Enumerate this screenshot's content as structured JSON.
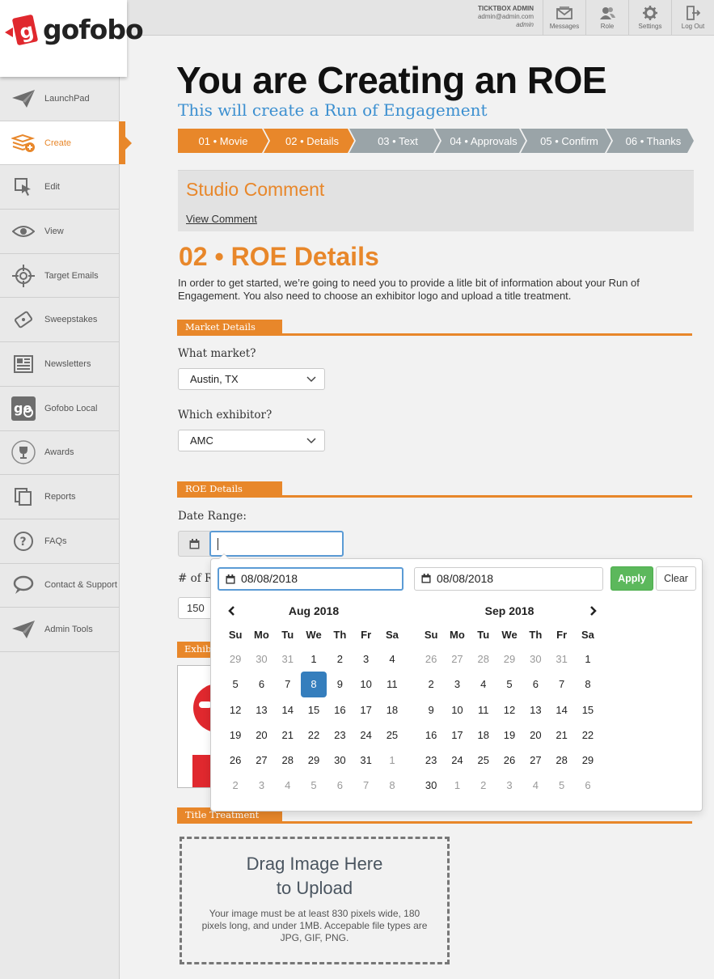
{
  "brand": {
    "name": "gofobo",
    "accent": "#e8872a",
    "link_blue": "#3b8fd0"
  },
  "topbar": {
    "user_name": "TICKTBOX ADMIN",
    "user_email": "admin@admin.com",
    "user_role": "admin",
    "tools": [
      {
        "label": "Messages",
        "icon": "envelope-icon"
      },
      {
        "label": "Role",
        "icon": "users-icon"
      },
      {
        "label": "Settings",
        "icon": "gear-icon"
      },
      {
        "label": "Log Out",
        "icon": "logout-icon"
      }
    ]
  },
  "sidebar": {
    "items": [
      {
        "label": "LaunchPad",
        "icon": "paper-plane-icon"
      },
      {
        "label": "Create",
        "icon": "create-stack-icon",
        "active": true
      },
      {
        "label": "Edit",
        "icon": "cursor-edit-icon"
      },
      {
        "label": "View",
        "icon": "eye-icon"
      },
      {
        "label": "Target Emails",
        "icon": "target-icon"
      },
      {
        "label": "Sweepstakes",
        "icon": "ticket-icon"
      },
      {
        "label": "Newsletters",
        "icon": "newspaper-icon"
      },
      {
        "label": "Gofobo Local",
        "icon": "gofobo-local-icon"
      },
      {
        "label": "Awards",
        "icon": "trophy-icon"
      },
      {
        "label": "Reports",
        "icon": "reports-icon"
      },
      {
        "label": "FAQs",
        "icon": "question-icon"
      },
      {
        "label": "Contact & Support",
        "icon": "chat-bubble-icon"
      },
      {
        "label": "Admin Tools",
        "icon": "paper-plane-icon"
      }
    ]
  },
  "header": {
    "title": "You are Creating an ROE",
    "subtitle": "This will create a Run of Engagement"
  },
  "steps": [
    {
      "label": "01 • Movie",
      "state": "done"
    },
    {
      "label": "02 • Details",
      "state": "done"
    },
    {
      "label": "03 • Text",
      "state": "todo"
    },
    {
      "label": "04 • Approvals",
      "state": "todo"
    },
    {
      "label": "05 • Confirm",
      "state": "todo"
    },
    {
      "label": "06 • Thanks",
      "state": "todo"
    }
  ],
  "studio_comment": {
    "title": "Studio Comment",
    "link": "View Comment"
  },
  "section": {
    "title": "02 • ROE Details",
    "intro": "In order to get started, we’re going to need you to provide a litle bit of information about your Run of Engagement. You also need to choose an exhibitor logo and upload a title treatment."
  },
  "market": {
    "header": "Market Details",
    "market_label": "What market?",
    "market_value": "Austin, TX",
    "exhibitor_label": "Which exhibitor?",
    "exhibitor_value": "AMC"
  },
  "roe": {
    "header": "ROE Details",
    "date_label": "Date Range:",
    "date_value": "",
    "count_label": "# of R",
    "count_value": "150"
  },
  "exhibitor_logo": {
    "header": "Exhib"
  },
  "title_treatment": {
    "header": "Title Treatment",
    "drop_title": "Drag Image Here to Upload",
    "drop_line1": "Drag Image Here",
    "drop_line2": "to Upload",
    "drop_help": "Your image must be at least 830 pixels wide, 180 pixels long, and under 1MB. Accepable file types are JPG, GIF, PNG."
  },
  "datepicker": {
    "start": "08/08/2018",
    "end": "08/08/2018",
    "apply": "Apply",
    "clear": "Clear",
    "weekdays": [
      "Su",
      "Mo",
      "Tu",
      "We",
      "Th",
      "Fr",
      "Sa"
    ],
    "months": [
      {
        "title": "Aug 2018",
        "days": [
          {
            "d": "29",
            "off": true
          },
          {
            "d": "30",
            "off": true
          },
          {
            "d": "31",
            "off": true
          },
          {
            "d": "1"
          },
          {
            "d": "2"
          },
          {
            "d": "3"
          },
          {
            "d": "4"
          },
          {
            "d": "5"
          },
          {
            "d": "6"
          },
          {
            "d": "7"
          },
          {
            "d": "8",
            "sel": true
          },
          {
            "d": "9"
          },
          {
            "d": "10"
          },
          {
            "d": "11"
          },
          {
            "d": "12"
          },
          {
            "d": "13"
          },
          {
            "d": "14"
          },
          {
            "d": "15"
          },
          {
            "d": "16"
          },
          {
            "d": "17"
          },
          {
            "d": "18"
          },
          {
            "d": "19"
          },
          {
            "d": "20"
          },
          {
            "d": "21"
          },
          {
            "d": "22"
          },
          {
            "d": "23"
          },
          {
            "d": "24"
          },
          {
            "d": "25"
          },
          {
            "d": "26"
          },
          {
            "d": "27"
          },
          {
            "d": "28"
          },
          {
            "d": "29"
          },
          {
            "d": "30"
          },
          {
            "d": "31"
          },
          {
            "d": "1",
            "off": true
          },
          {
            "d": "2",
            "off": true
          },
          {
            "d": "3",
            "off": true
          },
          {
            "d": "4",
            "off": true
          },
          {
            "d": "5",
            "off": true
          },
          {
            "d": "6",
            "off": true
          },
          {
            "d": "7",
            "off": true
          },
          {
            "d": "8",
            "off": true
          }
        ]
      },
      {
        "title": "Sep 2018",
        "days": [
          {
            "d": "26",
            "off": true
          },
          {
            "d": "27",
            "off": true
          },
          {
            "d": "28",
            "off": true
          },
          {
            "d": "29",
            "off": true
          },
          {
            "d": "30",
            "off": true
          },
          {
            "d": "31",
            "off": true
          },
          {
            "d": "1"
          },
          {
            "d": "2"
          },
          {
            "d": "3"
          },
          {
            "d": "4"
          },
          {
            "d": "5"
          },
          {
            "d": "6"
          },
          {
            "d": "7"
          },
          {
            "d": "8"
          },
          {
            "d": "9"
          },
          {
            "d": "10"
          },
          {
            "d": "11"
          },
          {
            "d": "12"
          },
          {
            "d": "13"
          },
          {
            "d": "14"
          },
          {
            "d": "15"
          },
          {
            "d": "16"
          },
          {
            "d": "17"
          },
          {
            "d": "18"
          },
          {
            "d": "19"
          },
          {
            "d": "20"
          },
          {
            "d": "21"
          },
          {
            "d": "22"
          },
          {
            "d": "23"
          },
          {
            "d": "24"
          },
          {
            "d": "25"
          },
          {
            "d": "26"
          },
          {
            "d": "27"
          },
          {
            "d": "28"
          },
          {
            "d": "29"
          },
          {
            "d": "30"
          },
          {
            "d": "1",
            "off": true
          },
          {
            "d": "2",
            "off": true
          },
          {
            "d": "3",
            "off": true
          },
          {
            "d": "4",
            "off": true
          },
          {
            "d": "5",
            "off": true
          },
          {
            "d": "6",
            "off": true
          }
        ]
      }
    ]
  }
}
